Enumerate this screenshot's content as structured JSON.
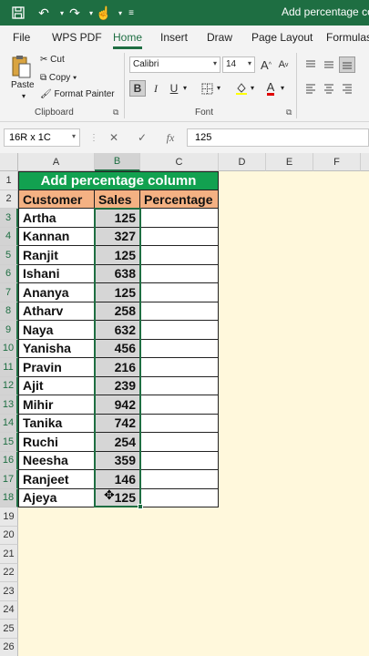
{
  "titlebar": {
    "doc_title": "Add percentage column",
    "icons": [
      "save-icon",
      "undo-icon",
      "redo-icon",
      "touch-mode-icon",
      "customize-icon"
    ]
  },
  "tabs": [
    "File",
    "WPS PDF",
    "Home",
    "Insert",
    "Draw",
    "Page Layout",
    "Formulas"
  ],
  "active_tab": "Home",
  "clipboard": {
    "paste": "Paste",
    "cut": "Cut",
    "copy": "Copy",
    "format_painter": "Format Painter",
    "label": "Clipboard"
  },
  "font": {
    "name": "Calibri",
    "size": "14",
    "bold": "B",
    "italic": "I",
    "underline": "U",
    "grow": "A",
    "shrink": "A",
    "label": "Font"
  },
  "formula_bar": {
    "name_box": "16R x 1C",
    "fx": "fx",
    "value": "125"
  },
  "columns": [
    "A",
    "B",
    "C",
    "D",
    "E",
    "F"
  ],
  "selected_column": "B",
  "rows": [
    "1",
    "2",
    "3",
    "4",
    "5",
    "6",
    "7",
    "8",
    "9",
    "10",
    "11",
    "12",
    "13",
    "14",
    "15",
    "16",
    "17",
    "18",
    "19",
    "20",
    "21",
    "22",
    "23",
    "24",
    "25",
    "26"
  ],
  "sheet": {
    "title": "Add percentage column",
    "headers": [
      "Customer",
      "Sales",
      "Percentage"
    ],
    "data": [
      {
        "customer": "Artha",
        "sales": "125"
      },
      {
        "customer": "Kannan",
        "sales": "327"
      },
      {
        "customer": "Ranjit",
        "sales": "125"
      },
      {
        "customer": "Ishani",
        "sales": "638"
      },
      {
        "customer": "Ananya",
        "sales": "125"
      },
      {
        "customer": "Atharv",
        "sales": "258"
      },
      {
        "customer": "Naya",
        "sales": "632"
      },
      {
        "customer": "Yanisha",
        "sales": "456"
      },
      {
        "customer": "Pravin",
        "sales": "216"
      },
      {
        "customer": "Ajit",
        "sales": "239"
      },
      {
        "customer": "Mihir",
        "sales": "942"
      },
      {
        "customer": "Tanika",
        "sales": "742"
      },
      {
        "customer": "Ruchi",
        "sales": "254"
      },
      {
        "customer": "Neesha",
        "sales": "359"
      },
      {
        "customer": "Ranjeet",
        "sales": "146"
      },
      {
        "customer": "Ajeya",
        "sales": "125"
      }
    ]
  },
  "colors": {
    "excel_green": "#1e6e42",
    "title_fill": "#12a150",
    "header_fill": "#f4b183",
    "sheet_background": "#fff8dc"
  }
}
